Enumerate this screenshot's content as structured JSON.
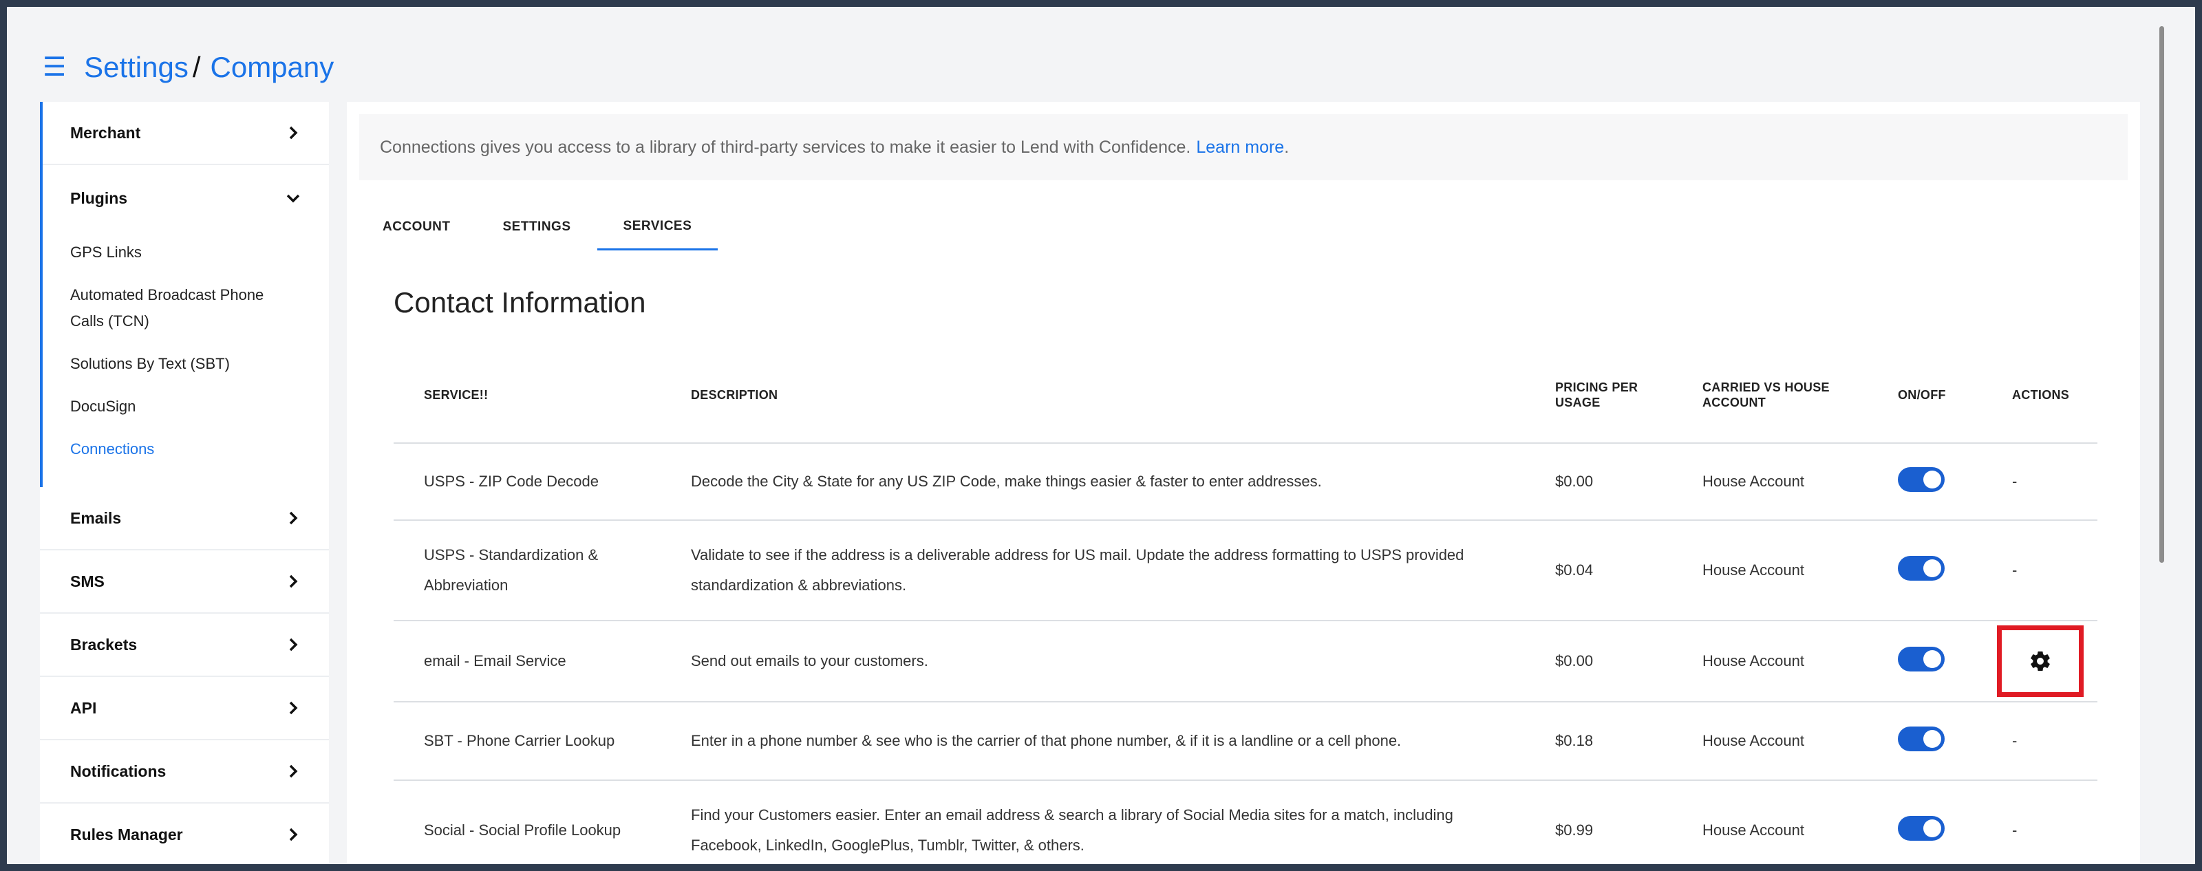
{
  "breadcrumb": {
    "root": "Settings",
    "separator": "/",
    "current": "Company"
  },
  "sidebar": {
    "merchant": "Merchant",
    "plugins": "Plugins",
    "plugin_items": [
      "GPS Links",
      "Automated Broadcast Phone Calls (TCN)",
      "Solutions By Text (SBT)",
      "DocuSign",
      "Connections"
    ],
    "sections": [
      "Emails",
      "SMS",
      "Brackets",
      "API",
      "Notifications",
      "Rules Manager"
    ]
  },
  "banner": {
    "text": "Connections gives you access to a library of third-party services to make it easier to Lend with Confidence.",
    "link": "Learn more",
    "period": "."
  },
  "tabs": [
    "ACCOUNT",
    "SETTINGS",
    "SERVICES"
  ],
  "section_title": "Contact Information",
  "table": {
    "headers": [
      "SERVICE!!",
      "DESCRIPTION",
      "PRICING PER USAGE",
      "CARRIED VS HOUSE ACCOUNT",
      "ON/OFF",
      "ACTIONS"
    ],
    "rows": [
      {
        "service": "USPS - ZIP Code Decode",
        "description": "Decode the City & State for any US ZIP Code, make things easier & faster to enter addresses.",
        "price": "$0.00",
        "account": "House Account",
        "action": "-"
      },
      {
        "service": "USPS - Standardization & Abbreviation",
        "description": "Validate to see if the address is a deliverable address for US mail. Update the address formatting to USPS provided standardization & abbreviations.",
        "price": "$0.04",
        "account": "House Account",
        "action": "-"
      },
      {
        "service": "email - Email Service",
        "description": "Send out emails to your customers.",
        "price": "$0.00",
        "account": "House Account",
        "action": ""
      },
      {
        "service": "SBT - Phone Carrier Lookup",
        "description": "Enter in a phone number & see who is the carrier of that phone number, & if it is a landline or a cell phone.",
        "price": "$0.18",
        "account": "House Account",
        "action": "-"
      },
      {
        "service": "Social - Social Profile Lookup",
        "description": "Find your Customers easier. Enter an email address & search a library of Social Media sites for a match, including Facebook, LinkedIn, GooglePlus, Tumblr, Twitter, & others.",
        "price": "$0.99",
        "account": "House Account",
        "action": "-"
      }
    ]
  },
  "colors": {
    "accent": "#1a73e8",
    "toggle_on": "#1a5fd0",
    "highlight": "#e01b24"
  }
}
